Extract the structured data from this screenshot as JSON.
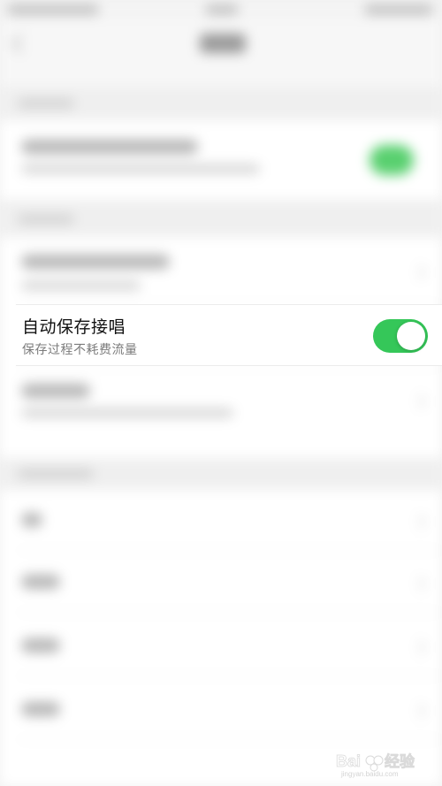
{
  "settings": {
    "auto_save": {
      "title": "自动保存接唱",
      "subtitle": "保存过程不耗费流量",
      "enabled": true
    }
  },
  "colors": {
    "toggle_on": "#35c759",
    "toggle_knob": "#ffffff",
    "title_text": "#111111",
    "subtitle_text": "#7b7b7b"
  },
  "icons": {
    "back": "chevron-left-icon",
    "arrow": "chevron-right-icon"
  },
  "watermark": {
    "brand": "Bai 经验",
    "url": "jingyan.baidu.com"
  }
}
